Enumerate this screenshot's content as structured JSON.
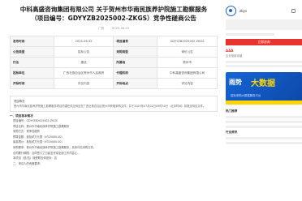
{
  "title_line1": "中科高盛咨询集团有限公司 关于贺州市华南民族养护院施工勘察服务",
  "title_line2": "（项目编号：GDYYZB2025002-ZKGS）竞争性磋商公告",
  "meta": {
    "publisher": "广西",
    "views": "2025-06-05"
  },
  "info_rows": [
    {
      "k1": "发布时间",
      "v1": "2025-06-05",
      "k2": "项目编号",
      "v2": "GDYYZB2025002-ZKGS"
    },
    {
      "k1": "公告类型",
      "v1": "招标公告",
      "k2": "采购类型",
      "v2": "询价公告"
    },
    {
      "k1": "行业",
      "v1": "建设",
      "k2": "所属地",
      "v2": "贺州市"
    },
    {
      "k1": "招标单位",
      "v1": "广西壮族自治区贺州市人民政府",
      "k2": "代理机构",
      "v2": "中科高盛咨询集团有限公司"
    },
    {
      "k1": "开标时间",
      "v1": "详见内容",
      "k2": "开标地点",
      "v2": "详见内容"
    }
  ],
  "box": {
    "lead": "项目概况",
    "line1": "贺州市华南民族养护院施工勘察服务项目的潜在供应商应在广西壮族自治区贺州市获取采购文件，并于2025年07月02日09时30分（北京时间）前提交响应文件。",
    "line2": "一、项目基本情况"
  },
  "section": {
    "heading": "一、项目基本情况",
    "rows": [
      "项目编号：GDYYZB2025002-ZKGS",
      "项目名称：贺州市华南民族养护院施工勘察服务",
      "采购方式：竞争性磋商",
      "预算金额：叁拾贰万元整（¥320000.00）",
      "最高限价：叁拾贰万元整（¥320000.00）",
      "采购需求：贺州市华南民族养护院施工勘察服务，具体详见采购文件。",
      "合同履行期限：合同签订之日起至完成全部工作内容止。",
      "本项目（是/否）接受联合体投标：否",
      "二、申请人的资格要求："
    ]
  },
  "side": {
    "brand": "zbys",
    "button": "立即咨询",
    "aaa": "AAA",
    "desc": "企业信用评级",
    "banner_t1": "雨势",
    "banner_t2": "大数据",
    "banner_sub": "招标采购大数据服务平台",
    "hot_title": "热门推荐",
    "bottom_title": "行业资讯"
  }
}
